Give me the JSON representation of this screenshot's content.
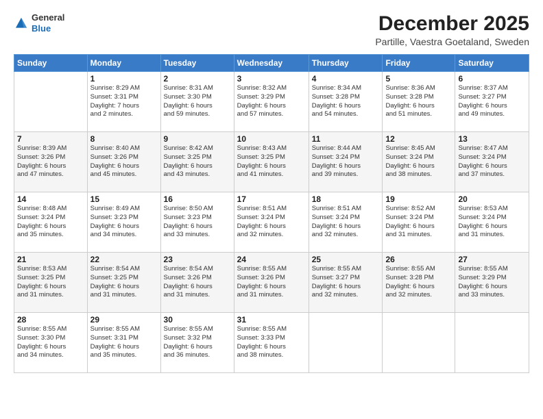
{
  "header": {
    "logo": {
      "line1": "General",
      "line2": "Blue"
    },
    "title": "December 2025",
    "subtitle": "Partille, Vaestra Goetaland, Sweden"
  },
  "days_of_week": [
    "Sunday",
    "Monday",
    "Tuesday",
    "Wednesday",
    "Thursday",
    "Friday",
    "Saturday"
  ],
  "weeks": [
    [
      {
        "day": "",
        "info": ""
      },
      {
        "day": "1",
        "info": "Sunrise: 8:29 AM\nSunset: 3:31 PM\nDaylight: 7 hours\nand 2 minutes."
      },
      {
        "day": "2",
        "info": "Sunrise: 8:31 AM\nSunset: 3:30 PM\nDaylight: 6 hours\nand 59 minutes."
      },
      {
        "day": "3",
        "info": "Sunrise: 8:32 AM\nSunset: 3:29 PM\nDaylight: 6 hours\nand 57 minutes."
      },
      {
        "day": "4",
        "info": "Sunrise: 8:34 AM\nSunset: 3:28 PM\nDaylight: 6 hours\nand 54 minutes."
      },
      {
        "day": "5",
        "info": "Sunrise: 8:36 AM\nSunset: 3:28 PM\nDaylight: 6 hours\nand 51 minutes."
      },
      {
        "day": "6",
        "info": "Sunrise: 8:37 AM\nSunset: 3:27 PM\nDaylight: 6 hours\nand 49 minutes."
      }
    ],
    [
      {
        "day": "7",
        "info": "Sunrise: 8:39 AM\nSunset: 3:26 PM\nDaylight: 6 hours\nand 47 minutes."
      },
      {
        "day": "8",
        "info": "Sunrise: 8:40 AM\nSunset: 3:26 PM\nDaylight: 6 hours\nand 45 minutes."
      },
      {
        "day": "9",
        "info": "Sunrise: 8:42 AM\nSunset: 3:25 PM\nDaylight: 6 hours\nand 43 minutes."
      },
      {
        "day": "10",
        "info": "Sunrise: 8:43 AM\nSunset: 3:25 PM\nDaylight: 6 hours\nand 41 minutes."
      },
      {
        "day": "11",
        "info": "Sunrise: 8:44 AM\nSunset: 3:24 PM\nDaylight: 6 hours\nand 39 minutes."
      },
      {
        "day": "12",
        "info": "Sunrise: 8:45 AM\nSunset: 3:24 PM\nDaylight: 6 hours\nand 38 minutes."
      },
      {
        "day": "13",
        "info": "Sunrise: 8:47 AM\nSunset: 3:24 PM\nDaylight: 6 hours\nand 37 minutes."
      }
    ],
    [
      {
        "day": "14",
        "info": "Sunrise: 8:48 AM\nSunset: 3:24 PM\nDaylight: 6 hours\nand 35 minutes."
      },
      {
        "day": "15",
        "info": "Sunrise: 8:49 AM\nSunset: 3:23 PM\nDaylight: 6 hours\nand 34 minutes."
      },
      {
        "day": "16",
        "info": "Sunrise: 8:50 AM\nSunset: 3:23 PM\nDaylight: 6 hours\nand 33 minutes."
      },
      {
        "day": "17",
        "info": "Sunrise: 8:51 AM\nSunset: 3:24 PM\nDaylight: 6 hours\nand 32 minutes."
      },
      {
        "day": "18",
        "info": "Sunrise: 8:51 AM\nSunset: 3:24 PM\nDaylight: 6 hours\nand 32 minutes."
      },
      {
        "day": "19",
        "info": "Sunrise: 8:52 AM\nSunset: 3:24 PM\nDaylight: 6 hours\nand 31 minutes."
      },
      {
        "day": "20",
        "info": "Sunrise: 8:53 AM\nSunset: 3:24 PM\nDaylight: 6 hours\nand 31 minutes."
      }
    ],
    [
      {
        "day": "21",
        "info": "Sunrise: 8:53 AM\nSunset: 3:25 PM\nDaylight: 6 hours\nand 31 minutes."
      },
      {
        "day": "22",
        "info": "Sunrise: 8:54 AM\nSunset: 3:25 PM\nDaylight: 6 hours\nand 31 minutes."
      },
      {
        "day": "23",
        "info": "Sunrise: 8:54 AM\nSunset: 3:26 PM\nDaylight: 6 hours\nand 31 minutes."
      },
      {
        "day": "24",
        "info": "Sunrise: 8:55 AM\nSunset: 3:26 PM\nDaylight: 6 hours\nand 31 minutes."
      },
      {
        "day": "25",
        "info": "Sunrise: 8:55 AM\nSunset: 3:27 PM\nDaylight: 6 hours\nand 32 minutes."
      },
      {
        "day": "26",
        "info": "Sunrise: 8:55 AM\nSunset: 3:28 PM\nDaylight: 6 hours\nand 32 minutes."
      },
      {
        "day": "27",
        "info": "Sunrise: 8:55 AM\nSunset: 3:29 PM\nDaylight: 6 hours\nand 33 minutes."
      }
    ],
    [
      {
        "day": "28",
        "info": "Sunrise: 8:55 AM\nSunset: 3:30 PM\nDaylight: 6 hours\nand 34 minutes."
      },
      {
        "day": "29",
        "info": "Sunrise: 8:55 AM\nSunset: 3:31 PM\nDaylight: 6 hours\nand 35 minutes."
      },
      {
        "day": "30",
        "info": "Sunrise: 8:55 AM\nSunset: 3:32 PM\nDaylight: 6 hours\nand 36 minutes."
      },
      {
        "day": "31",
        "info": "Sunrise: 8:55 AM\nSunset: 3:33 PM\nDaylight: 6 hours\nand 38 minutes."
      },
      {
        "day": "",
        "info": ""
      },
      {
        "day": "",
        "info": ""
      },
      {
        "day": "",
        "info": ""
      }
    ]
  ]
}
